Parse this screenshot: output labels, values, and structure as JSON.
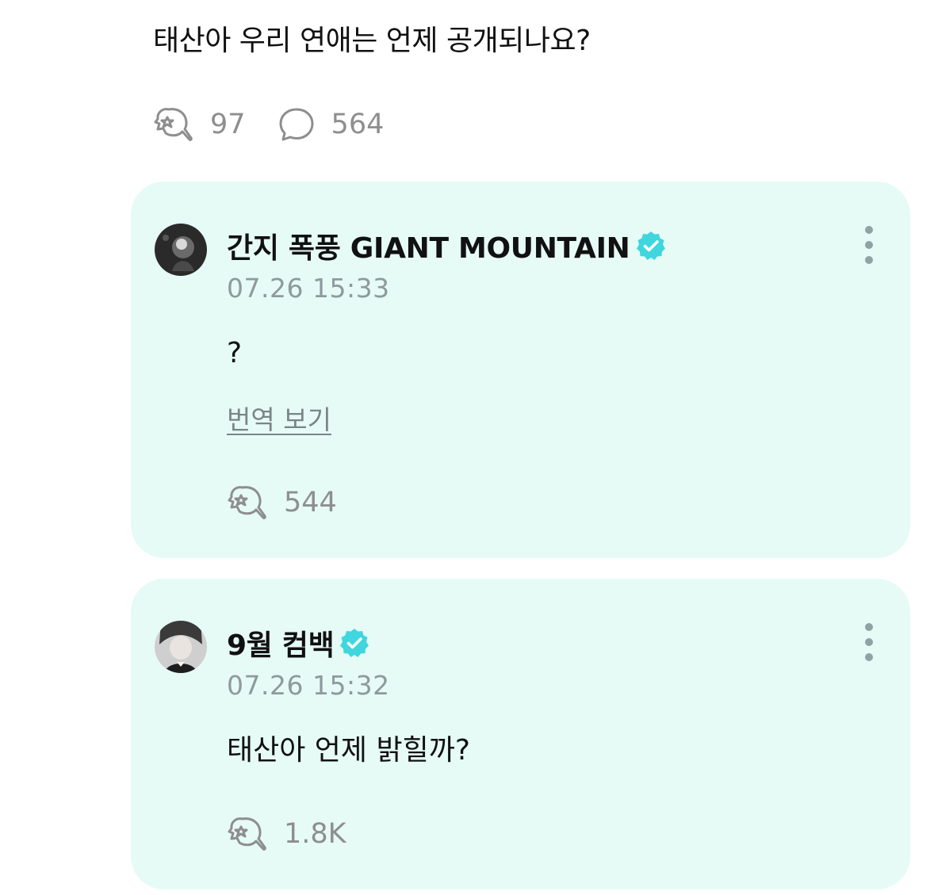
{
  "post": {
    "text": "태산아 우리 연애는 언제 공개되나요?",
    "like_icon": "star-heart-icon",
    "like_count": "97",
    "comment_icon": "speech-bubble-icon",
    "comment_count": "564"
  },
  "comments": [
    {
      "author": "간지 폭풍 GIANT MOUNTAIN",
      "verified": true,
      "date": "07.26 15:33",
      "text": "?",
      "translate_label": "번역 보기",
      "like_count": "544"
    },
    {
      "author": "9월 컴백",
      "verified": true,
      "date": "07.26 15:32",
      "text": "태산아 언제 밝힐까?",
      "like_count": "1.8K"
    }
  ],
  "colors": {
    "card_background": "#e6fbf6",
    "verified_badge": "#3fd6de",
    "muted_text": "#8e8e8e"
  }
}
